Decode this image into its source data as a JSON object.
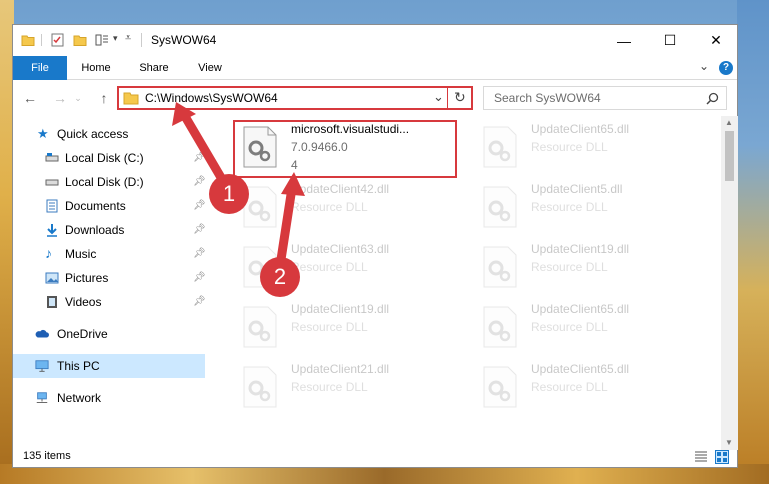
{
  "window": {
    "title": "SysWOW64",
    "minimize_glyph": "—",
    "maximize_glyph": "☐",
    "close_glyph": "✕"
  },
  "ribbon": {
    "tabs": [
      "File",
      "Home",
      "Share",
      "View"
    ],
    "help_glyph": "?",
    "expand_glyph": "⌄"
  },
  "nav": {
    "address": "C:\\Windows\\SysWOW64",
    "search_placeholder": "Search SysWOW64"
  },
  "sidebar": {
    "quick_access": "Quick access",
    "items": [
      {
        "label": "Local Disk (C:)",
        "icon": "drive-icon"
      },
      {
        "label": "Local Disk (D:)",
        "icon": "drive-icon"
      },
      {
        "label": "Documents",
        "icon": "documents-icon"
      },
      {
        "label": "Downloads",
        "icon": "downloads-icon"
      },
      {
        "label": "Music",
        "icon": "music-icon"
      },
      {
        "label": "Pictures",
        "icon": "pictures-icon"
      },
      {
        "label": "Videos",
        "icon": "videos-icon"
      }
    ],
    "onedrive": "OneDrive",
    "this_pc": "This PC",
    "network": "Network"
  },
  "files": {
    "featured": {
      "name": "microsoft.visualstudi...",
      "version": "7.0.9466.0",
      "extra": "4"
    },
    "left_column": [
      {
        "name": "UpdateClient42.dll",
        "type": "Resource DLL"
      },
      {
        "name": "UpdateClient63.dll",
        "type": "Resource DLL"
      },
      {
        "name": "UpdateClient19.dll",
        "type": "Resource DLL"
      },
      {
        "name": "UpdateClient21.dll",
        "type": "Resource DLL"
      }
    ],
    "right_column": [
      {
        "name": "UpdateClient65.dll",
        "type": "Resource DLL"
      },
      {
        "name": "UpdateClient5.dll",
        "type": "Resource DLL"
      },
      {
        "name": "UpdateClient19.dll",
        "type": "Resource DLL"
      },
      {
        "name": "UpdateClient65.dll",
        "type": "Resource DLL"
      },
      {
        "name": "UpdateClient65.dll",
        "type": "Resource DLL"
      }
    ]
  },
  "status": {
    "item_count": "135 items"
  },
  "annotations": {
    "badge1": "1",
    "badge2": "2",
    "color": "#d7393d"
  }
}
